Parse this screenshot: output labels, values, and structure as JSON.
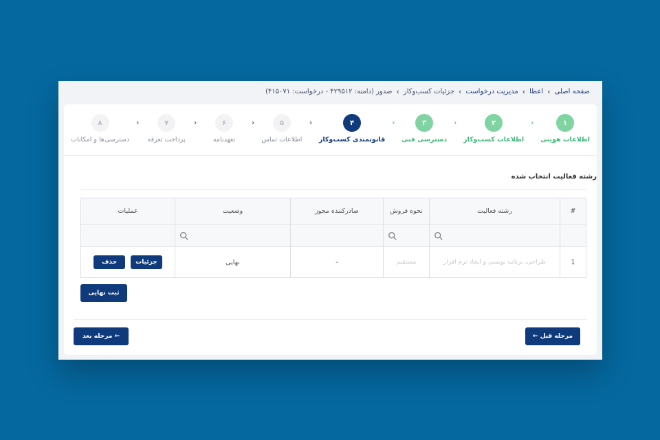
{
  "breadcrumb": {
    "items": [
      "صفحه اصلی",
      "اعطا",
      "مدیریت درخواست",
      "جزئیات کسب‌وکار",
      "صدور (دامنه: ۴۲۹۵۱۲ - درخواست: ۴۱۵۰۷۱)"
    ],
    "separator": "›"
  },
  "stepper": {
    "steps": [
      {
        "num": "۱",
        "label": "اطلاعات هویتی",
        "state": "done"
      },
      {
        "num": "۲",
        "label": "اطلاعات کسب‌وکار",
        "state": "done"
      },
      {
        "num": "۳",
        "label": "دسترسی فنی",
        "state": "done"
      },
      {
        "num": "۴",
        "label": "قانونمندی کسب‌وکار",
        "state": "active"
      },
      {
        "num": "۵",
        "label": "اطلاعات تماس",
        "state": "todo"
      },
      {
        "num": "۶",
        "label": "تعهدنامه",
        "state": "todo"
      },
      {
        "num": "۷",
        "label": "پرداخت تعرفه",
        "state": "todo"
      },
      {
        "num": "۸",
        "label": "دسترسی‌ها و امکانات",
        "state": "todo"
      }
    ]
  },
  "section": {
    "title": "رشته فعالیت انتخاب شده"
  },
  "table": {
    "headers": [
      "#",
      "رشته فعالیت",
      "نحوه فروش",
      "صادرکننده مجوز",
      "وضعیت",
      "عملیات"
    ],
    "rows": [
      {
        "index": "1",
        "activity": "طراحی، برنامه نویسی و ایجاد نرم افزار",
        "sale_method": "مستقیم",
        "issuer": "-",
        "status": "نهایی"
      }
    ],
    "actions": {
      "details": "جزئیات",
      "delete": "حذف"
    }
  },
  "buttons": {
    "submit": "ثبت نهایی",
    "prev": "← مرحله قبل",
    "next": "مرحله بعد ←"
  },
  "colors": {
    "background": "#05689f",
    "primary": "#0f3b7c",
    "done": "#7fd4a1",
    "done_text": "#3fb877"
  }
}
